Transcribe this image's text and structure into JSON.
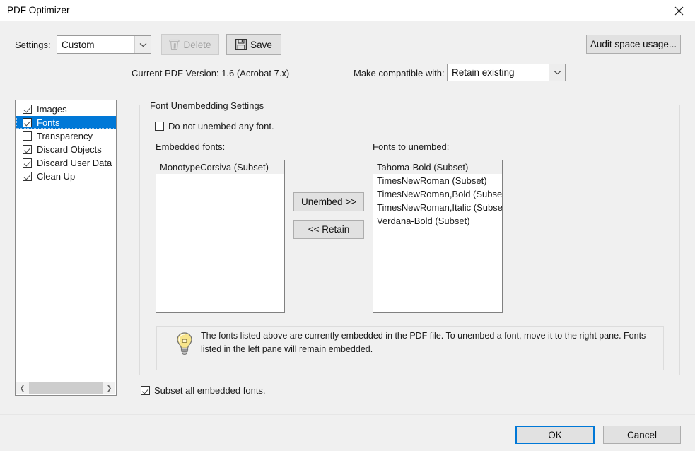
{
  "window": {
    "title": "PDF Optimizer",
    "close_icon": "close-icon"
  },
  "toolbar": {
    "settings_label": "Settings:",
    "settings_value": "Custom",
    "delete_label": "Delete",
    "delete_icon": "trash-icon",
    "delete_disabled": true,
    "save_label": "Save",
    "save_icon": "floppy-disk-icon",
    "audit_label": "Audit space usage..."
  },
  "info": {
    "pdf_version": "Current PDF Version: 1.6 (Acrobat 7.x)",
    "compat_label": "Make compatible with:",
    "compat_value": "Retain existing"
  },
  "sidebar": {
    "items": [
      {
        "label": "Images",
        "checked": true,
        "selected": false
      },
      {
        "label": "Fonts",
        "checked": true,
        "selected": true
      },
      {
        "label": "Transparency",
        "checked": false,
        "selected": false
      },
      {
        "label": "Discard Objects",
        "checked": true,
        "selected": false
      },
      {
        "label": "Discard User Data",
        "checked": true,
        "selected": false
      },
      {
        "label": "Clean Up",
        "checked": true,
        "selected": false
      }
    ],
    "scroll_left_icon": "chevron-left-icon",
    "scroll_right_icon": "chevron-right-icon"
  },
  "panel": {
    "group_title": "Font Unembedding Settings",
    "do_not_unembed_label": "Do not unembed any font.",
    "do_not_unembed_checked": false,
    "embedded_label": "Embedded fonts:",
    "unembed_label": "Fonts to unembed:",
    "embedded_fonts": [
      {
        "name": "MonotypeCorsiva (Subset)",
        "highlighted": true
      }
    ],
    "fonts_to_unembed": [
      {
        "name": "Tahoma-Bold (Subset)",
        "highlighted": true
      },
      {
        "name": "TimesNewRoman (Subset)",
        "highlighted": false
      },
      {
        "name": "TimesNewRoman,Bold (Subset)",
        "highlighted": false
      },
      {
        "name": "TimesNewRoman,Italic (Subset)",
        "highlighted": false
      },
      {
        "name": "Verdana-Bold (Subset)",
        "highlighted": false
      }
    ],
    "unembed_button": "Unembed >>",
    "retain_button": "<< Retain",
    "tip_icon": "lightbulb-icon",
    "tip_text": "The fonts listed above are currently embedded in the PDF file. To unembed a font, move it to the right pane. Fonts listed in the left pane will remain embedded.",
    "subset_all_label": "Subset all embedded fonts.",
    "subset_all_checked": true
  },
  "footer": {
    "ok_label": "OK",
    "cancel_label": "Cancel"
  },
  "colors": {
    "accent": "#0078d7",
    "window_bg": "#f0f0f0",
    "titlebar_bg": "#ffffff",
    "button_bg": "#e1e1e1",
    "bulb_yellow": "#f8e58c"
  }
}
